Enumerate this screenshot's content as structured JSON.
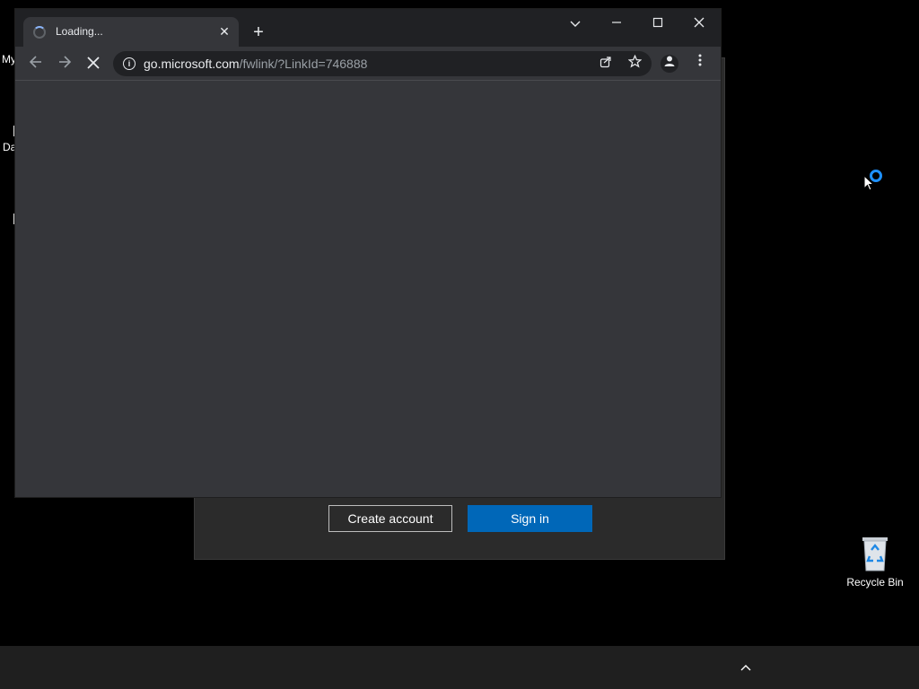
{
  "desktop": {
    "left_fragments": [
      "My",
      "Da"
    ],
    "recycle_bin_label": "Recycle Bin"
  },
  "background_dialog": {
    "create_account_label": "Create account",
    "sign_in_label": "Sign in",
    "accent_color": "#0067b8"
  },
  "browser": {
    "tab": {
      "title": "Loading..."
    },
    "address": {
      "host": "go.microsoft.com",
      "path": "/fwlink/?LinkId=746888"
    },
    "icons": {
      "tab_spinner": "loading-spinner-icon",
      "tab_close": "close-icon",
      "new_tab": "plus-icon",
      "tab_search": "chevron-down-icon",
      "minimize": "minimize-icon",
      "maximize": "maximize-icon",
      "close": "close-icon",
      "back": "arrow-left-icon",
      "forward": "arrow-right-icon",
      "stop": "stop-x-icon",
      "site_info": "info-icon",
      "share": "share-icon",
      "bookmark": "star-icon",
      "profile": "person-icon",
      "menu": "kebab-menu-icon"
    }
  },
  "taskbar": {
    "tray_icon": "chevron-up-icon"
  }
}
